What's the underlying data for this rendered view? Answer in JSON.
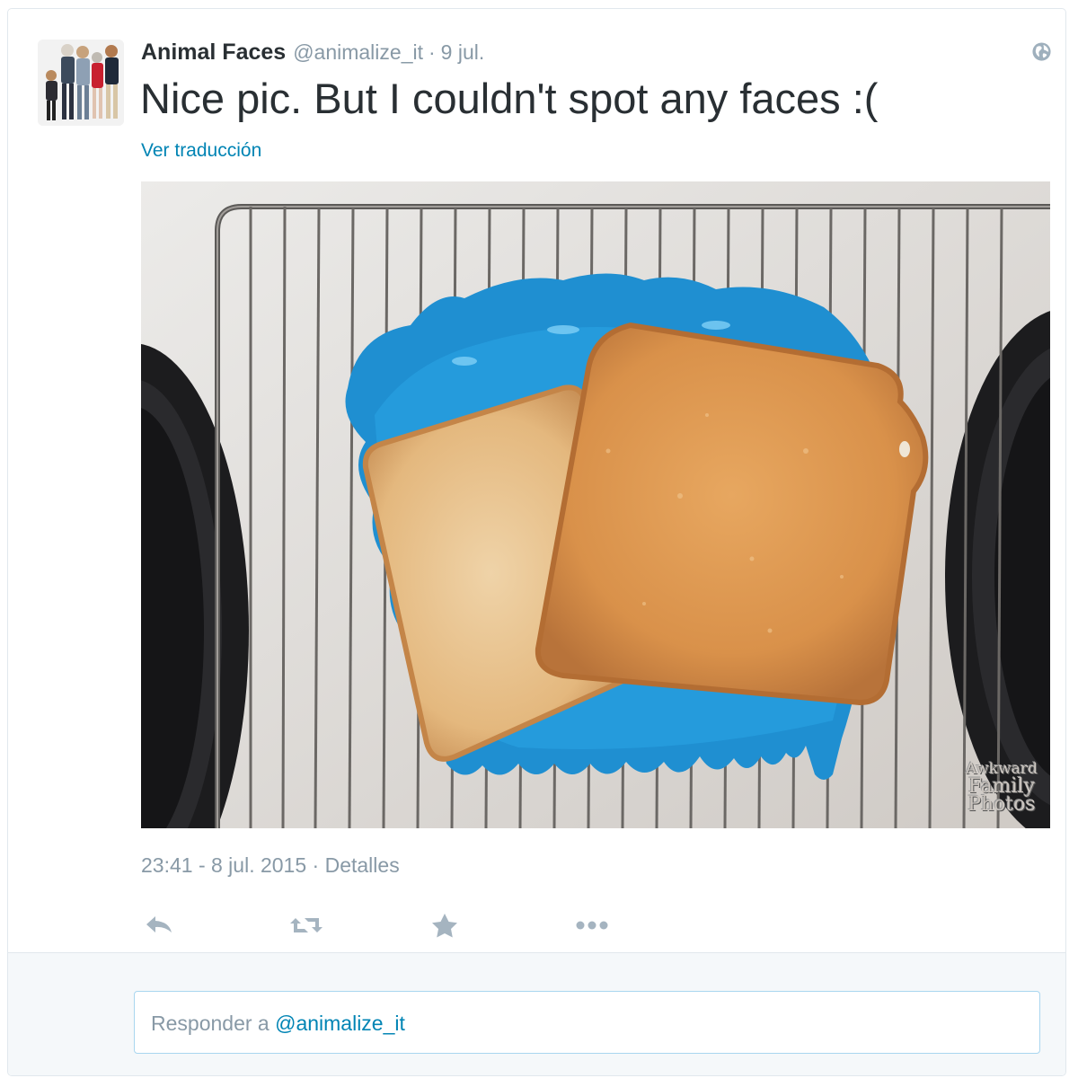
{
  "tweet": {
    "author_name": "Animal Faces",
    "author_handle": "@animalize_it",
    "separator": "·",
    "date_short": "9 jul.",
    "text": "Nice pic. But I couldn't spot any faces :(",
    "translate_label": "Ver traducción",
    "timestamp": "23:41 - 8 jul. 2015",
    "details_label": "Detalles",
    "media_watermark": [
      "Awkward",
      "Family",
      "Photos"
    ]
  },
  "actions": {
    "reply_icon": "reply-icon",
    "retweet_icon": "retweet-icon",
    "favorite_icon": "star-icon",
    "more_icon": "more-dots-icon"
  },
  "reply": {
    "placeholder_prefix": "Responder a",
    "placeholder_handle": "@animalize_it"
  },
  "colors": {
    "text": "#292f33",
    "muted": "#8899a6",
    "link": "#0084b4",
    "icon": "#a5b4c0",
    "border": "#e1e8ed",
    "reply_bg": "#f5f8fa"
  }
}
